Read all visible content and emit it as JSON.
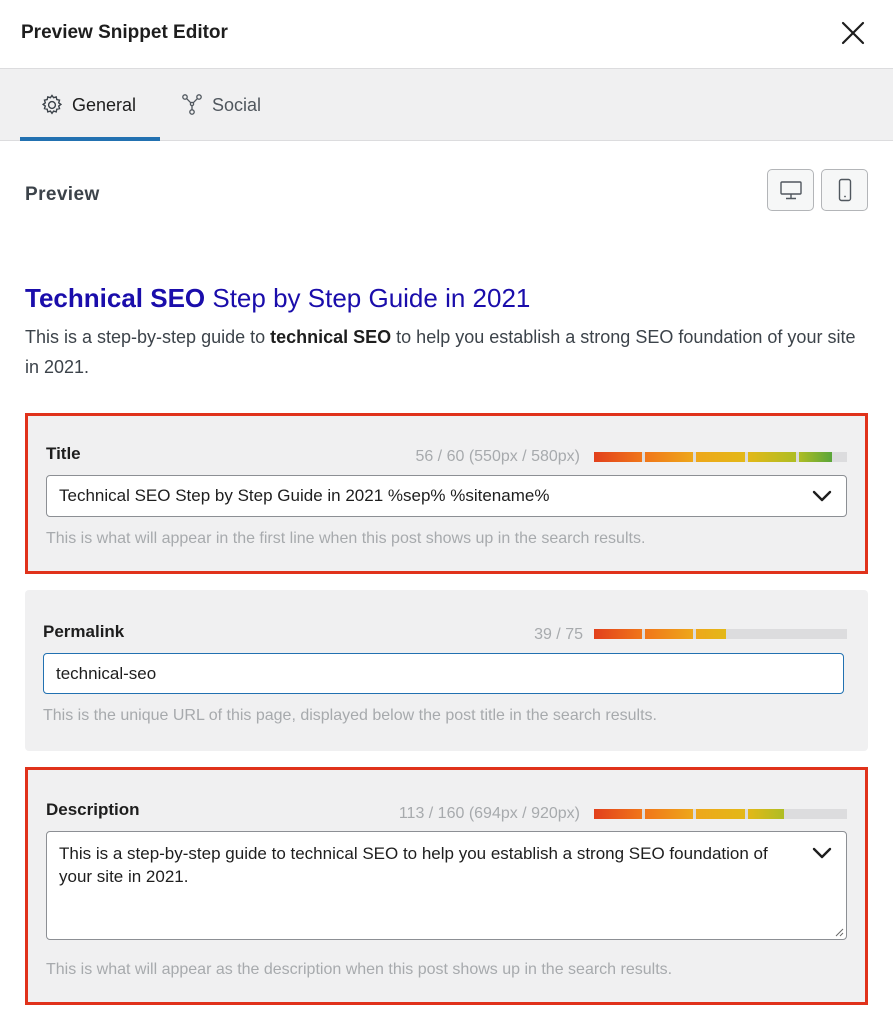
{
  "header": {
    "title": "Preview Snippet Editor"
  },
  "tabs": [
    {
      "label": "General",
      "icon": "gear-icon",
      "active": true
    },
    {
      "label": "Social",
      "icon": "share-nodes-icon",
      "active": false
    }
  ],
  "preview": {
    "label": "Preview",
    "devices": [
      "desktop-icon",
      "mobile-icon"
    ],
    "serp_title_bold": "Technical SEO",
    "serp_title_rest": " Step by Step Guide in 2021",
    "serp_desc_before": "This is a step-by-step guide to ",
    "serp_desc_bold": "technical SEO",
    "serp_desc_after": " to help you establish a strong SEO foundation of your site in 2021."
  },
  "title_field": {
    "label": "Title",
    "count": "56 / 60 (550px / 580px)",
    "value": "Technical SEO Step by Step Guide in 2021 %sep% %sitename%",
    "help": "This is what will appear in the first line when this post shows up in the search results.",
    "fill": 0.94
  },
  "permalink_field": {
    "label": "Permalink",
    "count": "39 / 75",
    "value": "technical-seo",
    "help": "This is the unique URL of this page, displayed below the post title in the search results.",
    "fill": 0.52
  },
  "description_field": {
    "label": "Description",
    "count": "113 / 160 (694px / 920px)",
    "value": "This is a step-by-step guide to technical SEO to help you establish a strong SEO foundation of your site in 2021.",
    "help": "This is what will appear as the description when this post shows up in the search results.",
    "fill": 0.75
  },
  "colors": {
    "accent": "#2271b1",
    "serp_link": "#1a0dab",
    "highlight_border": "#e0321b",
    "meter": [
      "#e2401c",
      "#f0761a",
      "#eea71a",
      "#e3b818",
      "#aebd24",
      "#5aa53a"
    ]
  }
}
